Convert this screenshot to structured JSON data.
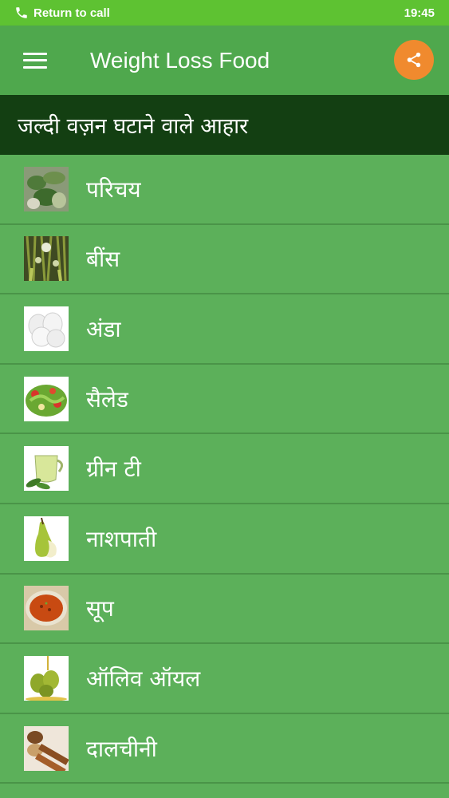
{
  "status_bar": {
    "call_text": "Return to call",
    "time": "19:45"
  },
  "app_bar": {
    "title": "Weight Loss Food",
    "menu_icon": "hamburger-menu-icon",
    "share_icon": "share-icon",
    "share_color": "#f08a2e"
  },
  "section": {
    "title": "जल्दी वज़न घटाने वाले आहार"
  },
  "items": [
    {
      "label": "परिचय",
      "thumb": "intro-image"
    },
    {
      "label": "बींस",
      "thumb": "beans-image"
    },
    {
      "label": "अंडा",
      "thumb": "egg-image"
    },
    {
      "label": "सैलेड",
      "thumb": "salad-image"
    },
    {
      "label": "ग्रीन टी",
      "thumb": "green-tea-image"
    },
    {
      "label": "नाशपाती",
      "thumb": "pear-image"
    },
    {
      "label": "सूप",
      "thumb": "soup-image"
    },
    {
      "label": "ऑलिव ऑयल",
      "thumb": "olive-oil-image"
    },
    {
      "label": "दालचीनी",
      "thumb": "cinnamon-image"
    }
  ],
  "colors": {
    "status_bar": "#5ec232",
    "app_bar": "#4fa84d",
    "header": "#133f12",
    "list_bg": "#5cb05a"
  }
}
